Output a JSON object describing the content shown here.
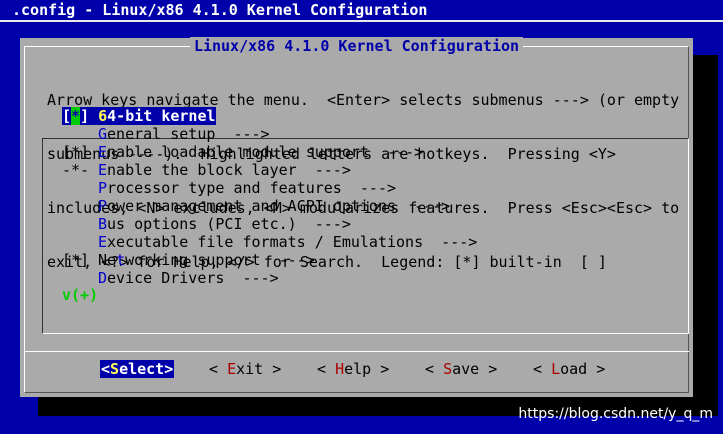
{
  "window": {
    "title": ".config - Linux/x86 4.1.0 Kernel Configuration"
  },
  "dialog": {
    "title": "Linux/x86 4.1.0 Kernel Configuration",
    "help_lines": [
      "Arrow keys navigate the menu.  <Enter> selects submenus ---> (or empty",
      "submenus ----).  Highlighted letters are hotkeys.  Pressing <Y>",
      "includes, <N> excludes, <M> modularizes features.  Press <Esc><Esc> to",
      "exit, <?> for Help, </> for Search.  Legend: [*] built-in  [ ]"
    ]
  },
  "menu": {
    "items": [
      {
        "prefix": "[*]",
        "hot": "6",
        "rest": "4-bit kernel",
        "selected": true
      },
      {
        "prefix": "   ",
        "hot": "G",
        "rest": "eneral setup  --->"
      },
      {
        "prefix": "[*]",
        "hot": "E",
        "rest": "nable loadable module support  --->"
      },
      {
        "prefix": "-*-",
        "hot": "E",
        "rest": "nable the block layer  --->"
      },
      {
        "prefix": "   ",
        "hot": "P",
        "rest": "rocessor type and features  --->"
      },
      {
        "prefix": "   ",
        "hot": "P",
        "rest": "ower management and ACPI options  --->"
      },
      {
        "prefix": "   ",
        "hot": "B",
        "rest": "us options (PCI etc.)  --->"
      },
      {
        "prefix": "   ",
        "hot": "E",
        "rest": "xecutable file formats / Emulations  --->"
      },
      {
        "prefix": "[*]",
        "pre": "Ne",
        "hot": "t",
        "rest": "working support  --->"
      },
      {
        "prefix": "   ",
        "hot": "D",
        "rest": "evice Drivers  --->"
      }
    ],
    "more_indicator": "v(+)"
  },
  "buttons": {
    "select": {
      "open": "<",
      "hot": "S",
      "rest": "elect",
      "close": ">"
    },
    "exit": {
      "open": "< ",
      "hot": "E",
      "rest": "xit",
      "close": " >"
    },
    "help": {
      "open": "< ",
      "hot": "H",
      "rest": "elp",
      "close": " >"
    },
    "save": {
      "open": "< ",
      "hot": "S",
      "rest": "ave",
      "close": " >"
    },
    "load": {
      "open": "< ",
      "hot": "L",
      "rest": "oad",
      "close": " >"
    }
  },
  "watermark": "https://blog.csdn.net/y_q_m",
  "colors": {
    "background": "#0000aa",
    "dialog": "#aaaaaa",
    "hotkey": "#0000cc",
    "button_hotkey": "#aa0000",
    "more_indicator": "#00cc00"
  }
}
